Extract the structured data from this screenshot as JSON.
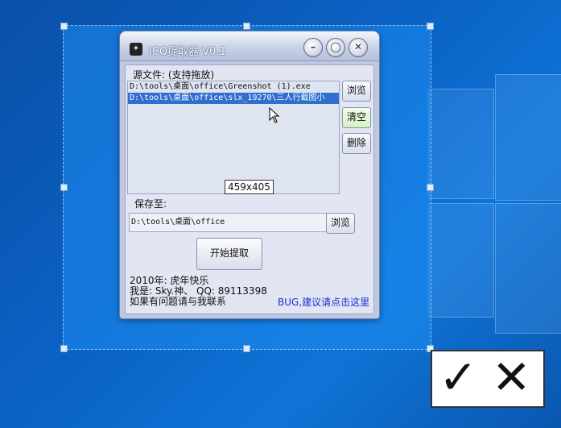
{
  "window": {
    "title": "ICO提取器 V0.1",
    "buttons": {
      "minimize": "–",
      "maximize": "◯",
      "close": "✕"
    }
  },
  "source": {
    "label": "源文件: (支持拖放)",
    "files": [
      {
        "path": "D:\\tools\\桌面\\office\\Greenshot (1).exe",
        "selected": false
      },
      {
        "path": "D:\\tools\\桌面\\office\\slx_19270\\三人行截图小",
        "selected": true
      }
    ],
    "browse_label": "浏览",
    "clear_label": "清空",
    "delete_label": "删除"
  },
  "tooltip": {
    "text": "459x405"
  },
  "output": {
    "label": "保存至:",
    "path": "D:\\tools\\桌面\\office",
    "browse_label": "浏览"
  },
  "start_label": "开始提取",
  "info": {
    "line1": "2010年: 虎年快乐",
    "line2": "我是: Sky.神、 QQ: 89113398",
    "line3": "如果有问题请与我联系"
  },
  "feedback_link": "BUG,建议请点击这里",
  "colors": {
    "accent": "#2e6fd0",
    "desktop": "#0b63c6",
    "link": "#1a2fd0"
  },
  "icons": {
    "app": "app-icon",
    "cursor": "mouse-cursor-icon"
  }
}
